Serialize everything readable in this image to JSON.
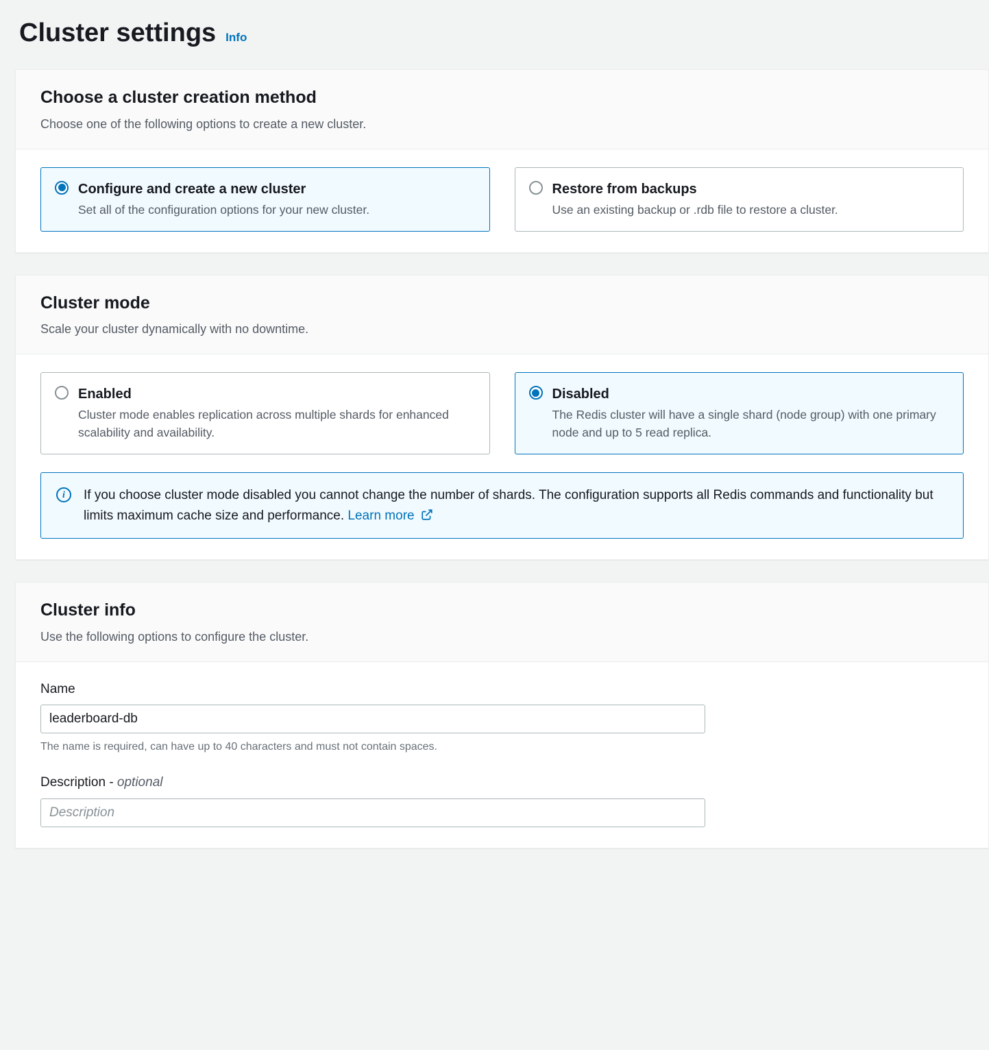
{
  "header": {
    "title": "Cluster settings",
    "info_label": "Info"
  },
  "creation_method": {
    "title": "Choose a cluster creation method",
    "subtitle": "Choose one of the following options to create a new cluster.",
    "options": [
      {
        "title": "Configure and create a new cluster",
        "desc": "Set all of the configuration options for your new cluster.",
        "selected": true
      },
      {
        "title": "Restore from backups",
        "desc": "Use an existing backup or .rdb file to restore a cluster.",
        "selected": false
      }
    ]
  },
  "cluster_mode": {
    "title": "Cluster mode",
    "subtitle": "Scale your cluster dynamically with no downtime.",
    "options": [
      {
        "title": "Enabled",
        "desc": "Cluster mode enables replication across multiple shards for enhanced scalability and availability.",
        "selected": false
      },
      {
        "title": "Disabled",
        "desc": "The Redis cluster will have a single shard (node group) with one primary node and up to 5 read replica.",
        "selected": true
      }
    ],
    "alert_text": "If you choose cluster mode disabled you cannot change the number of shards. The configuration supports all Redis commands and functionality but limits maximum cache size and performance.",
    "learn_more": "Learn more"
  },
  "cluster_info": {
    "title": "Cluster info",
    "subtitle": "Use the following options to configure the cluster.",
    "name": {
      "label": "Name",
      "value": "leaderboard-db",
      "helper": "The name is required, can have up to 40 characters and must not contain spaces."
    },
    "description": {
      "label_main": "Description - ",
      "label_optional": "optional",
      "placeholder": "Description",
      "value": ""
    }
  }
}
